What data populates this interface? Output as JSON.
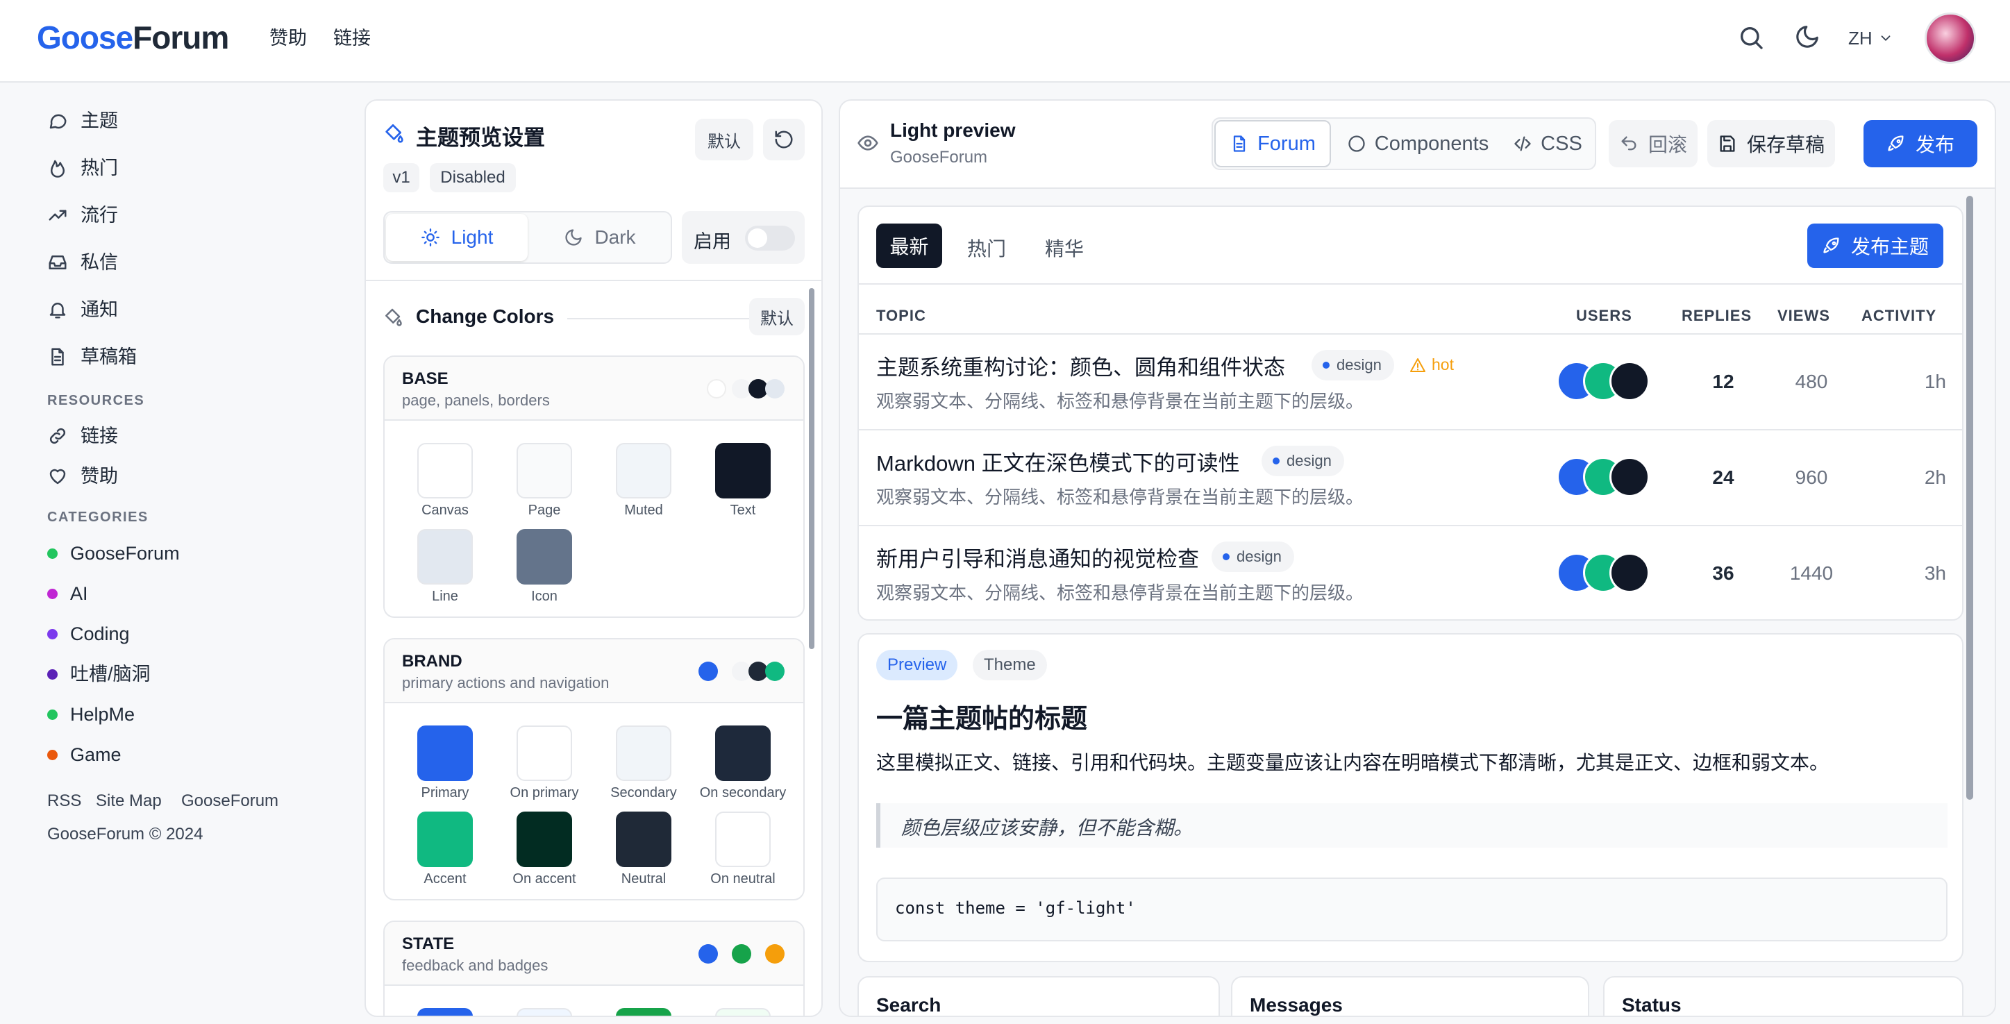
{
  "header": {
    "logo_a": "Goose",
    "logo_b": "Forum",
    "nav": [
      "赞助",
      "链接"
    ],
    "lang": "ZH"
  },
  "sidebar": {
    "items": [
      "主题",
      "热门",
      "流行",
      "私信",
      "通知",
      "草稿箱"
    ],
    "resources_heading": "RESOURCES",
    "resources": [
      "链接",
      "赞助"
    ],
    "categories_heading": "CATEGORIES",
    "categories": [
      {
        "name": "GooseForum",
        "color": "#22c55e"
      },
      {
        "name": "AI",
        "color": "#c026d3"
      },
      {
        "name": "Coding",
        "color": "#7c3aed"
      },
      {
        "name": "吐槽/脑洞",
        "color": "#5b21b6"
      },
      {
        "name": "HelpMe",
        "color": "#22c55e"
      },
      {
        "name": "Game",
        "color": "#ea580c"
      }
    ],
    "footer_links": [
      "RSS",
      "Site Map",
      "GooseForum"
    ],
    "copyright": "GooseForum © 2024"
  },
  "theme_panel": {
    "title": "主题预览设置",
    "default_btn": "默认",
    "version": "v1",
    "status": "Disabled",
    "mode_light": "Light",
    "mode_dark": "Dark",
    "enable_label": "启用",
    "colors_title": "Change Colors",
    "colors_default": "默认",
    "groups": {
      "base": {
        "title": "BASE",
        "subtitle": "page, panels, borders",
        "swatches": [
          {
            "label": "Canvas",
            "color": "#ffffff"
          },
          {
            "label": "Page",
            "color": "#f9fafb"
          },
          {
            "label": "Muted",
            "color": "#f1f5f9"
          },
          {
            "label": "Text",
            "color": "#111827"
          },
          {
            "label": "Line",
            "color": "#e2e8f0"
          },
          {
            "label": "Icon",
            "color": "#64748b"
          }
        ]
      },
      "brand": {
        "title": "BRAND",
        "subtitle": "primary actions and navigation",
        "swatches": [
          {
            "label": "Primary",
            "color": "#2563eb"
          },
          {
            "label": "On primary",
            "color": "#ffffff"
          },
          {
            "label": "Secondary",
            "color": "#f1f5f9"
          },
          {
            "label": "On secondary",
            "color": "#1e293b"
          },
          {
            "label": "Accent",
            "color": "#10b981"
          },
          {
            "label": "On accent",
            "color": "#022c22"
          },
          {
            "label": "Neutral",
            "color": "#1f2937"
          },
          {
            "label": "On neutral",
            "color": "#ffffff"
          }
        ]
      },
      "state": {
        "title": "STATE",
        "subtitle": "feedback and badges",
        "dots": [
          "#2563eb",
          "#16a34a",
          "#f59e0b"
        ]
      }
    }
  },
  "preview": {
    "title": "Light preview",
    "subtitle": "GooseForum",
    "tabs": [
      "Forum",
      "Components",
      "CSS"
    ],
    "rollback": "回滚",
    "save_draft": "保存草稿",
    "publish": "发布",
    "forum": {
      "filters": [
        "最新",
        "热门",
        "精华"
      ],
      "new_topic": "发布主题",
      "columns": [
        "TOPIC",
        "USERS",
        "REPLIES",
        "VIEWS",
        "ACTIVITY"
      ],
      "rows": [
        {
          "title": "主题系统重构讨论：颜色、圆角和组件状态",
          "tag": "design",
          "hot": "hot",
          "desc": "观察弱文本、分隔线、标签和悬停背景在当前主题下的层级。",
          "replies": "12",
          "views": "480",
          "activity": "1h"
        },
        {
          "title": "Markdown 正文在深色模式下的可读性",
          "tag": "design",
          "hot": "",
          "desc": "观察弱文本、分隔线、标签和悬停背景在当前主题下的层级。",
          "replies": "24",
          "views": "960",
          "activity": "2h"
        },
        {
          "title": "新用户引导和消息通知的视觉检查",
          "tag": "design",
          "hot": "",
          "desc": "观察弱文本、分隔线、标签和悬停背景在当前主题下的层级。",
          "replies": "36",
          "views": "1440",
          "activity": "3h"
        }
      ]
    },
    "article": {
      "badge_preview": "Preview",
      "badge_theme": "Theme",
      "title": "一篇主题帖的标题",
      "body": "这里模拟正文、链接、引用和代码块。主题变量应该让内容在明暗模式下都清晰，尤其是正文、边框和弱文本。",
      "quote": "颜色层级应该安静，但不能含糊。",
      "code": "const theme = 'gf-light'"
    },
    "bottom_cards": [
      "Search",
      "Messages",
      "Status"
    ]
  }
}
